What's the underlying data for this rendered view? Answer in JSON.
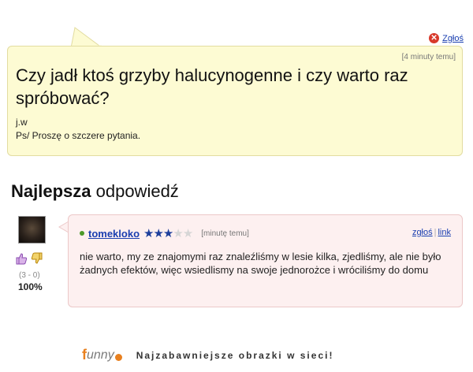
{
  "question": {
    "report_label": "Zgłoś",
    "time": "[4 minuty temu]",
    "title": "Czy jadł ktoś grzyby halucynogenne i czy warto raz spróbować?",
    "line1": "j.w",
    "line2": "Ps/ Proszę o szczere pytania."
  },
  "best_answer": {
    "heading_bold": "Najlepsza",
    "heading_rest": " odpowiedź",
    "author": "tomekloko",
    "rating": 3,
    "rating_max": 5,
    "time": "[minutę temu]",
    "report_label": "zgłoś",
    "link_label": "link",
    "votes": "(3 - 0)",
    "percent": "100%",
    "text": "nie warto, my ze znajomymi raz znaleźliśmy w lesie kilka, zjedliśmy, ale nie było żadnych efektów, więc wsiedlismy na swoje jednorożce i wróciliśmy do domu"
  },
  "footer": {
    "logo_letter": "f",
    "logo_rest": "unny",
    "tagline": "Najzabawniejsze obrazki w sieci!"
  },
  "colors": {
    "question_bg": "#fdfbd3",
    "answer_bg": "#fdf0f0",
    "link": "#1a3fb0",
    "accent": "#e8801f"
  }
}
